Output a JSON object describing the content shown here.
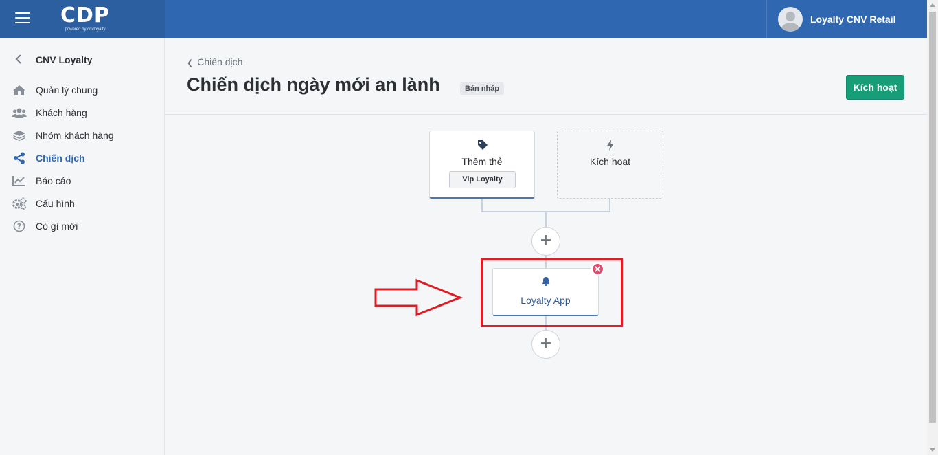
{
  "header": {
    "logo_text": "CDP",
    "logo_sub": "powered by cnvloyalty",
    "user_name": "Loyalty CNV Retail"
  },
  "sidebar": {
    "title": "CNV Loyalty",
    "items": [
      {
        "label": "Quản lý chung",
        "icon": "home-icon"
      },
      {
        "label": "Khách hàng",
        "icon": "users-icon"
      },
      {
        "label": "Nhóm khách hàng",
        "icon": "layers-icon"
      },
      {
        "label": "Chiến dịch",
        "icon": "share-icon",
        "active": true
      },
      {
        "label": "Báo cáo",
        "icon": "chart-icon"
      },
      {
        "label": "Cấu hình",
        "icon": "gears-icon"
      },
      {
        "label": "Có gì mới",
        "icon": "question-icon"
      }
    ]
  },
  "page": {
    "breadcrumb": "Chiến dịch",
    "title": "Chiến dịch ngày mới an lành",
    "status_badge": "Bản nháp",
    "activate_label": "Kích hoạt"
  },
  "flow": {
    "tag_card": {
      "label": "Thêm thẻ",
      "tag": "Vip Loyalty",
      "icon": "tag-icon"
    },
    "trigger_card": {
      "label": "Kích hoạt",
      "icon": "bolt-icon"
    },
    "app_card": {
      "label": "Loyalty App",
      "icon": "bell-icon"
    },
    "add_symbol": "+"
  },
  "colors": {
    "topbar": "#2f67b1",
    "accent": "#2f67b1",
    "activate_button": "#179d77",
    "highlight": "#e01c24",
    "remove": "#e4486a"
  }
}
